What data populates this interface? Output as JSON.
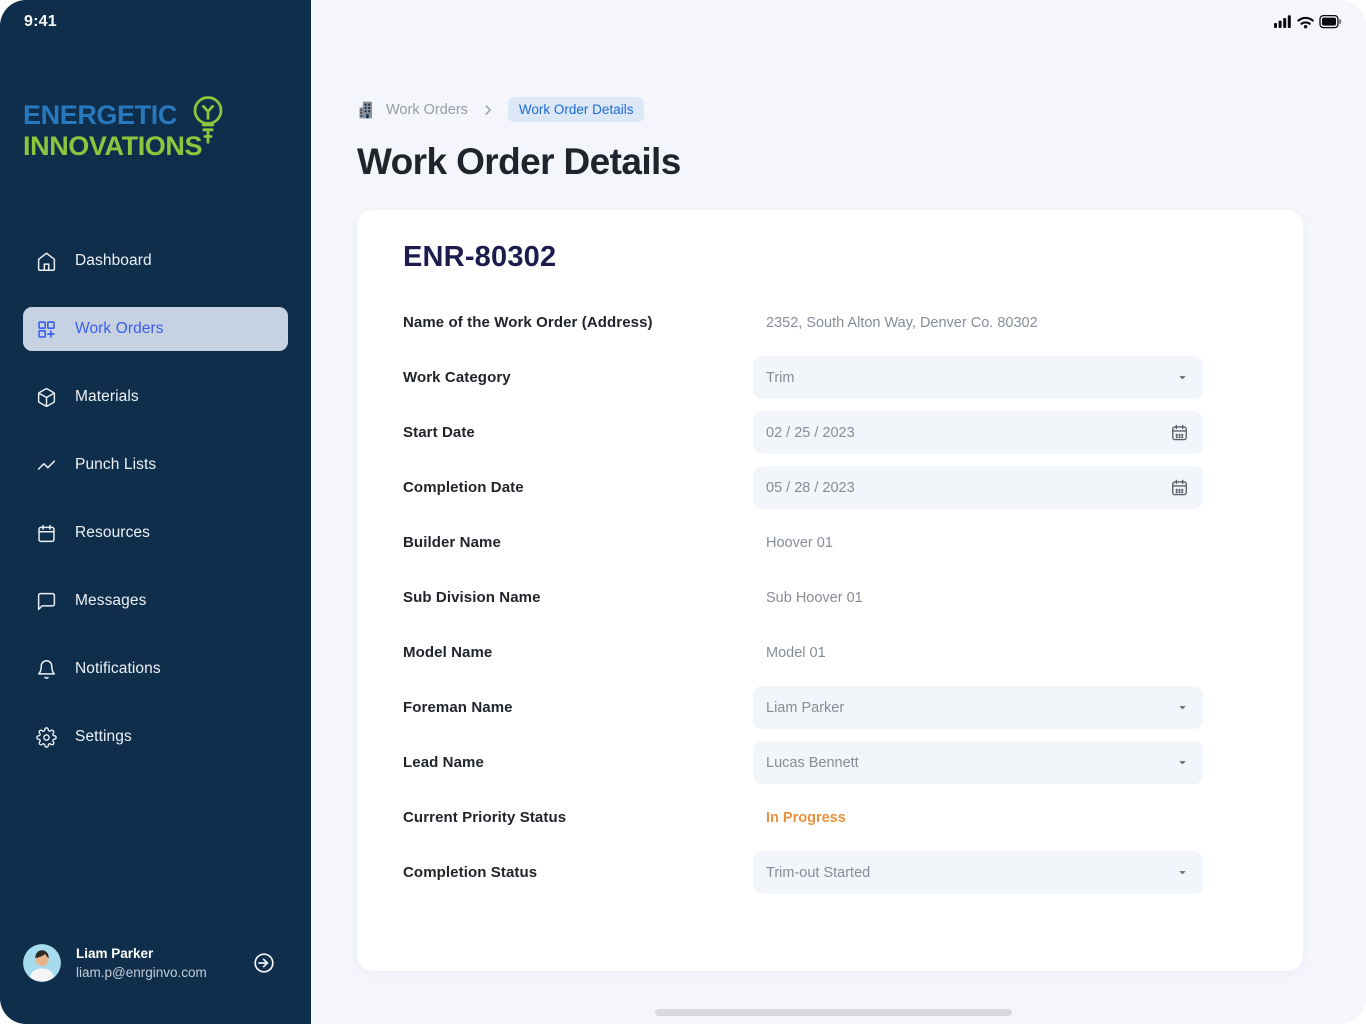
{
  "status_bar": {
    "time": "9:41"
  },
  "logo": {
    "line1": "ENERGETIC",
    "line2": "INNOVATIONS"
  },
  "sidebar": {
    "items": [
      {
        "label": "Dashboard",
        "icon": "home-icon",
        "active": false
      },
      {
        "label": "Work Orders",
        "icon": "grid-plus-icon",
        "active": true
      },
      {
        "label": "Materials",
        "icon": "package-icon",
        "active": false
      },
      {
        "label": "Punch Lists",
        "icon": "trending-line-icon",
        "active": false
      },
      {
        "label": "Resources",
        "icon": "calendar-icon",
        "active": false
      },
      {
        "label": "Messages",
        "icon": "chat-icon",
        "active": false
      },
      {
        "label": "Notifications",
        "icon": "bell-icon",
        "active": false
      },
      {
        "label": "Settings",
        "icon": "gear-icon",
        "active": false
      }
    ],
    "user": {
      "name": "Liam Parker",
      "email": "liam.p@enrginvo.com"
    }
  },
  "breadcrumb": {
    "parent": "Work Orders",
    "current": "Work Order Details"
  },
  "page": {
    "title": "Work Order Details"
  },
  "work_order": {
    "id": "ENR-80302",
    "fields": [
      {
        "label": "Name of the Work Order (Address)",
        "value": "2352, South Alton Way, Denver Co. 80302",
        "type": "text"
      },
      {
        "label": "Work Category",
        "value": "Trim",
        "type": "select"
      },
      {
        "label": "Start Date",
        "value": "02 / 25 / 2023",
        "type": "date"
      },
      {
        "label": "Completion Date",
        "value": "05 / 28 / 2023",
        "type": "date"
      },
      {
        "label": "Builder Name",
        "value": "Hoover 01",
        "type": "text"
      },
      {
        "label": "Sub Division Name",
        "value": "Sub Hoover 01",
        "type": "text"
      },
      {
        "label": "Model Name",
        "value": "Model 01",
        "type": "text"
      },
      {
        "label": "Foreman Name",
        "value": "Liam Parker",
        "type": "select"
      },
      {
        "label": "Lead Name",
        "value": "Lucas Bennett",
        "type": "select"
      },
      {
        "label": "Current Priority Status",
        "value": "In Progress",
        "type": "status"
      },
      {
        "label": "Completion Status",
        "value": "Trim-out Started",
        "type": "select"
      }
    ]
  },
  "colors": {
    "sidebar_bg": "#0E2E4B",
    "accent_blue": "#3A5EF0",
    "logo_blue": "#2878BE",
    "logo_green": "#8CC63F",
    "status_orange": "#E8923D",
    "breadcrumb_chip_bg": "#DCE8F8",
    "breadcrumb_chip_text": "#1E6BD9",
    "main_bg": "#F4F6FC",
    "input_bg": "#F2F5FA"
  }
}
